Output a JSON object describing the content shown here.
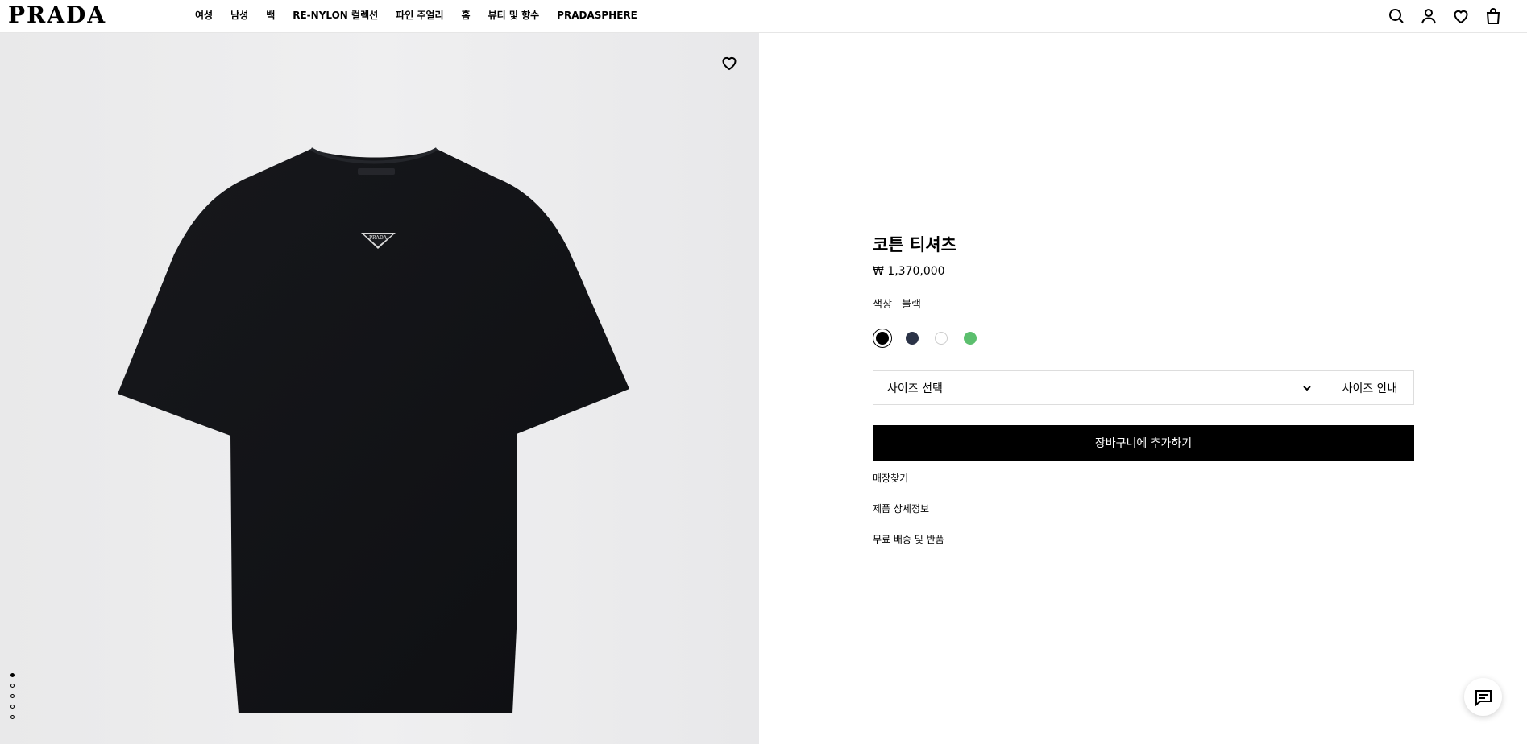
{
  "brand": {
    "logo": "PRADA"
  },
  "nav": {
    "items": [
      {
        "label": "여성"
      },
      {
        "label": "남성"
      },
      {
        "label": "백"
      },
      {
        "label": "RE-NYLON 컬렉션"
      },
      {
        "label": "파인 주얼리"
      },
      {
        "label": "홈"
      },
      {
        "label": "뷰티 및 향수"
      },
      {
        "label": "PRADASPHERE"
      }
    ]
  },
  "header_icons": [
    "search-icon",
    "account-icon",
    "wishlist-icon",
    "bag-icon"
  ],
  "gallery": {
    "image_label": "PRADA",
    "slide_count": 5,
    "active_slide": 1
  },
  "product": {
    "title": "코튼 티셔츠",
    "price": "₩ 1,370,000",
    "color_label": "색상",
    "color_value": "블랙",
    "swatches": [
      {
        "name": "black",
        "color": "#000000",
        "selected": true
      },
      {
        "name": "navy",
        "color": "#2b3347",
        "selected": false
      },
      {
        "name": "white",
        "color": "#ffffff",
        "selected": false
      },
      {
        "name": "green",
        "color": "#5cbf6e",
        "selected": false
      }
    ],
    "size_select": "사이즈 선택",
    "size_guide": "사이즈 안내",
    "add_to_cart": "장바구니에 추가하기",
    "links": [
      "매장찾기",
      "제품 상세정보",
      "무료 배송 및 반품"
    ]
  },
  "colors": {
    "accent": "#000000",
    "gallery_bg": "#ececed"
  }
}
